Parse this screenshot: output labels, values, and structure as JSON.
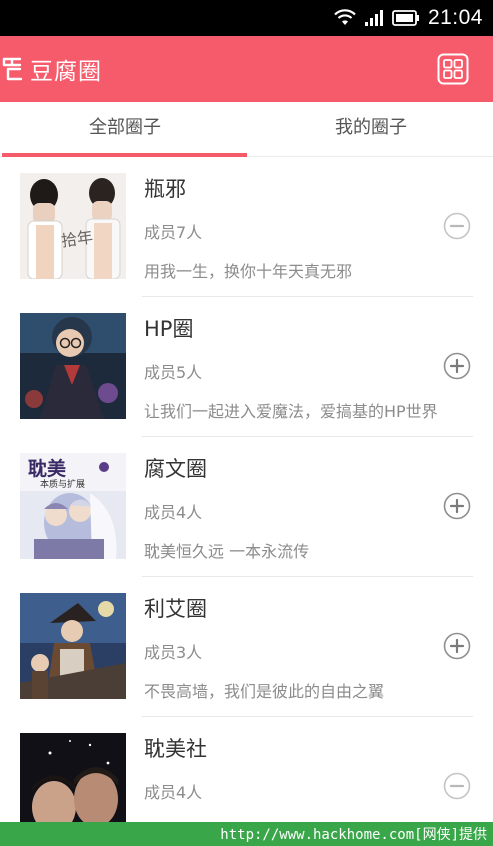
{
  "status_bar": {
    "time": "21:04",
    "icons": [
      "wifi-icon",
      "signal-icon",
      "battery-icon"
    ]
  },
  "app_bar": {
    "title": "豆腐圈",
    "logo_icon": "logo-icon",
    "menu_icon": "grid-icon",
    "color": "#f65b6c"
  },
  "tabs": [
    {
      "label": "全部圈子",
      "active": true
    },
    {
      "label": "我的圈子",
      "active": false
    }
  ],
  "circles": [
    {
      "name": "瓶邪",
      "members": "成员7人",
      "description": "用我一生，换你十年天真无邪",
      "action": "minus-circle-icon",
      "joined": true
    },
    {
      "name": "HP圈",
      "members": "成员5人",
      "description": "让我们一起进入爱魔法，爱搞基的HP世界",
      "action": "plus-circle-icon",
      "joined": false
    },
    {
      "name": "腐文圈",
      "members": "成员4人",
      "description": "耽美恒久远 一本永流传",
      "action": "plus-circle-icon",
      "joined": false
    },
    {
      "name": "利艾圈",
      "members": "成员3人",
      "description": "不畏高墙，我们是彼此的自由之翼",
      "action": "plus-circle-icon",
      "joined": false
    },
    {
      "name": "耽美社",
      "members": "成员4人",
      "description": "",
      "action": "minus-circle-icon",
      "joined": true
    }
  ],
  "thumb_texts": {
    "cover1": "拾年",
    "cover3_title": "耽美",
    "cover3_sub": "本质与扩展"
  },
  "watermark": {
    "text": "http://www.hackhome.com[网侠]提供",
    "color": "#3aa64a"
  }
}
